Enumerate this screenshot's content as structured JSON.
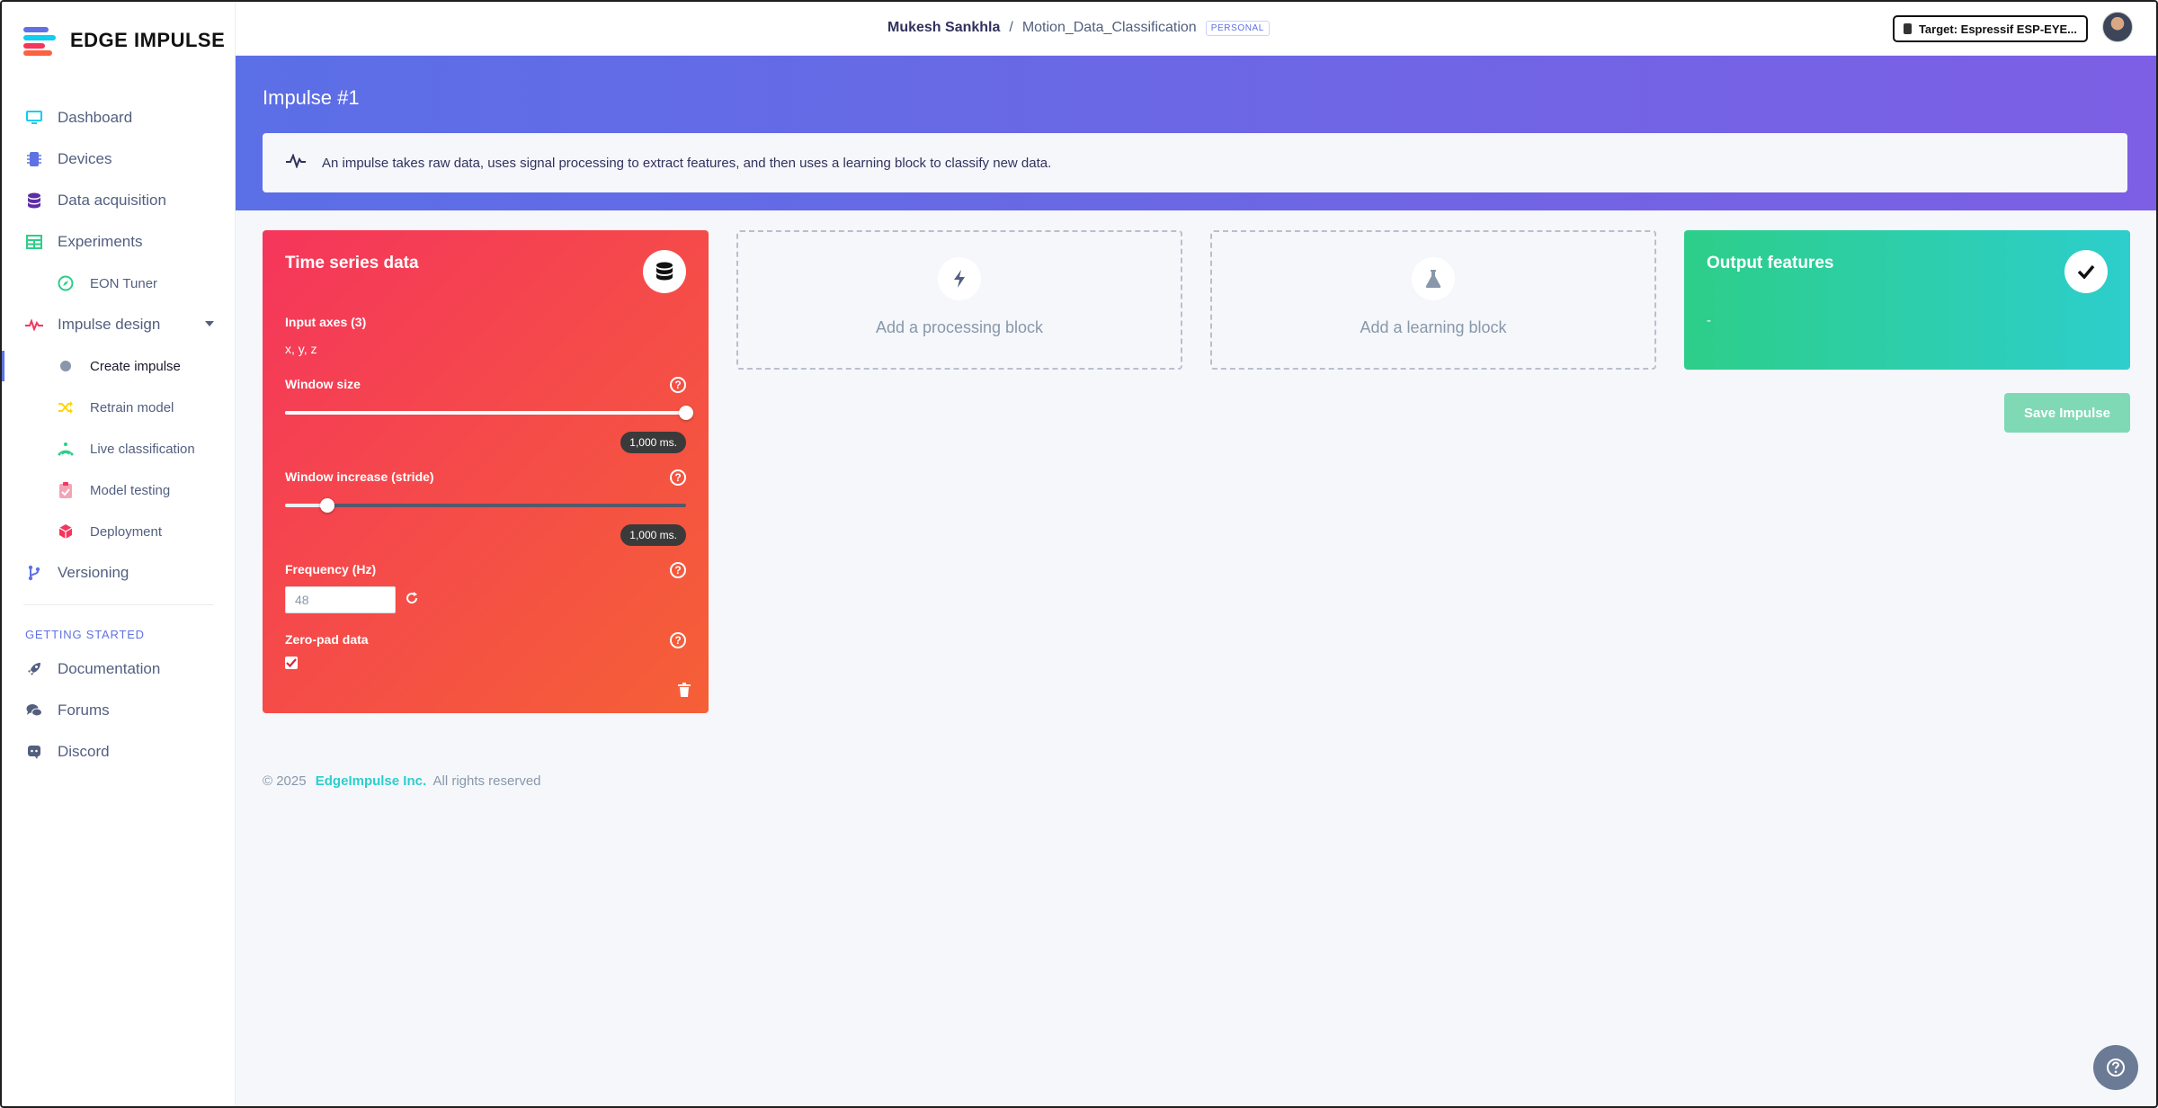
{
  "brand": {
    "name": "EDGE IMPULSE"
  },
  "sidebar": {
    "items": [
      {
        "label": "Dashboard",
        "icon": "monitor-icon",
        "color": "#11cdef"
      },
      {
        "label": "Devices",
        "icon": "chip-icon",
        "color": "#5e72e4"
      },
      {
        "label": "Data acquisition",
        "icon": "database-icon",
        "color": "#5e2ca5"
      },
      {
        "label": "Experiments",
        "icon": "table-icon",
        "color": "#2dce89"
      },
      {
        "label": "EON Tuner",
        "icon": "compass-icon",
        "color": "#2dce89"
      },
      {
        "label": "Impulse design",
        "icon": "pulse-icon",
        "color": "#f5365c"
      },
      {
        "label": "Create impulse",
        "icon": "dot-icon",
        "color": "#8898aa"
      },
      {
        "label": "Retrain model",
        "icon": "shuffle-icon",
        "color": "#ffd600"
      },
      {
        "label": "Live classification",
        "icon": "signal-icon",
        "color": "#2dce89"
      },
      {
        "label": "Model testing",
        "icon": "clipboard-check-icon",
        "color": "#f3a4b5"
      },
      {
        "label": "Deployment",
        "icon": "cube-icon",
        "color": "#f5365c"
      },
      {
        "label": "Versioning",
        "icon": "branch-icon",
        "color": "#5e72e4"
      }
    ],
    "section_title": "GETTING STARTED",
    "help_items": [
      {
        "label": "Documentation",
        "icon": "rocket-icon"
      },
      {
        "label": "Forums",
        "icon": "comments-icon"
      },
      {
        "label": "Discord",
        "icon": "discord-icon"
      }
    ]
  },
  "topbar": {
    "user": "Mukesh Sankhla",
    "separator": "/",
    "project": "Motion_Data_Classification",
    "badge": "PERSONAL",
    "target_label": "Target: Espressif ESP-EYE..."
  },
  "page": {
    "title": "Impulse #1",
    "info": "An impulse takes raw data, uses signal processing to extract features, and then uses a learning block to classify new data."
  },
  "input_block": {
    "title": "Time series data",
    "axes_label": "Input axes (3)",
    "axes_value": "x, y, z",
    "window_size_label": "Window size",
    "window_size_value": "1,000 ms.",
    "window_size_position": 1.0,
    "stride_label": "Window increase (stride)",
    "stride_value": "1,000 ms.",
    "stride_position": 0.105,
    "frequency_label": "Frequency (Hz)",
    "frequency_value": "48",
    "zero_pad_label": "Zero-pad data",
    "zero_pad_checked": true,
    "help_glyph": "?"
  },
  "processing_block": {
    "label": "Add a processing block"
  },
  "learning_block": {
    "label": "Add a learning block"
  },
  "output_block": {
    "title": "Output features",
    "value": "-"
  },
  "actions": {
    "save_label": "Save Impulse"
  },
  "footer": {
    "copyright": "© 2025",
    "company": "EdgeImpulse Inc.",
    "rights": "All rights reserved"
  },
  "colors": {
    "accent": "#5e72e4",
    "input_gradient": [
      "#f5365c",
      "#f56036"
    ],
    "output_gradient": [
      "#2dce89",
      "#2dcecc"
    ],
    "hero_gradient": [
      "#5b6fe6",
      "#7c5fe4"
    ]
  }
}
